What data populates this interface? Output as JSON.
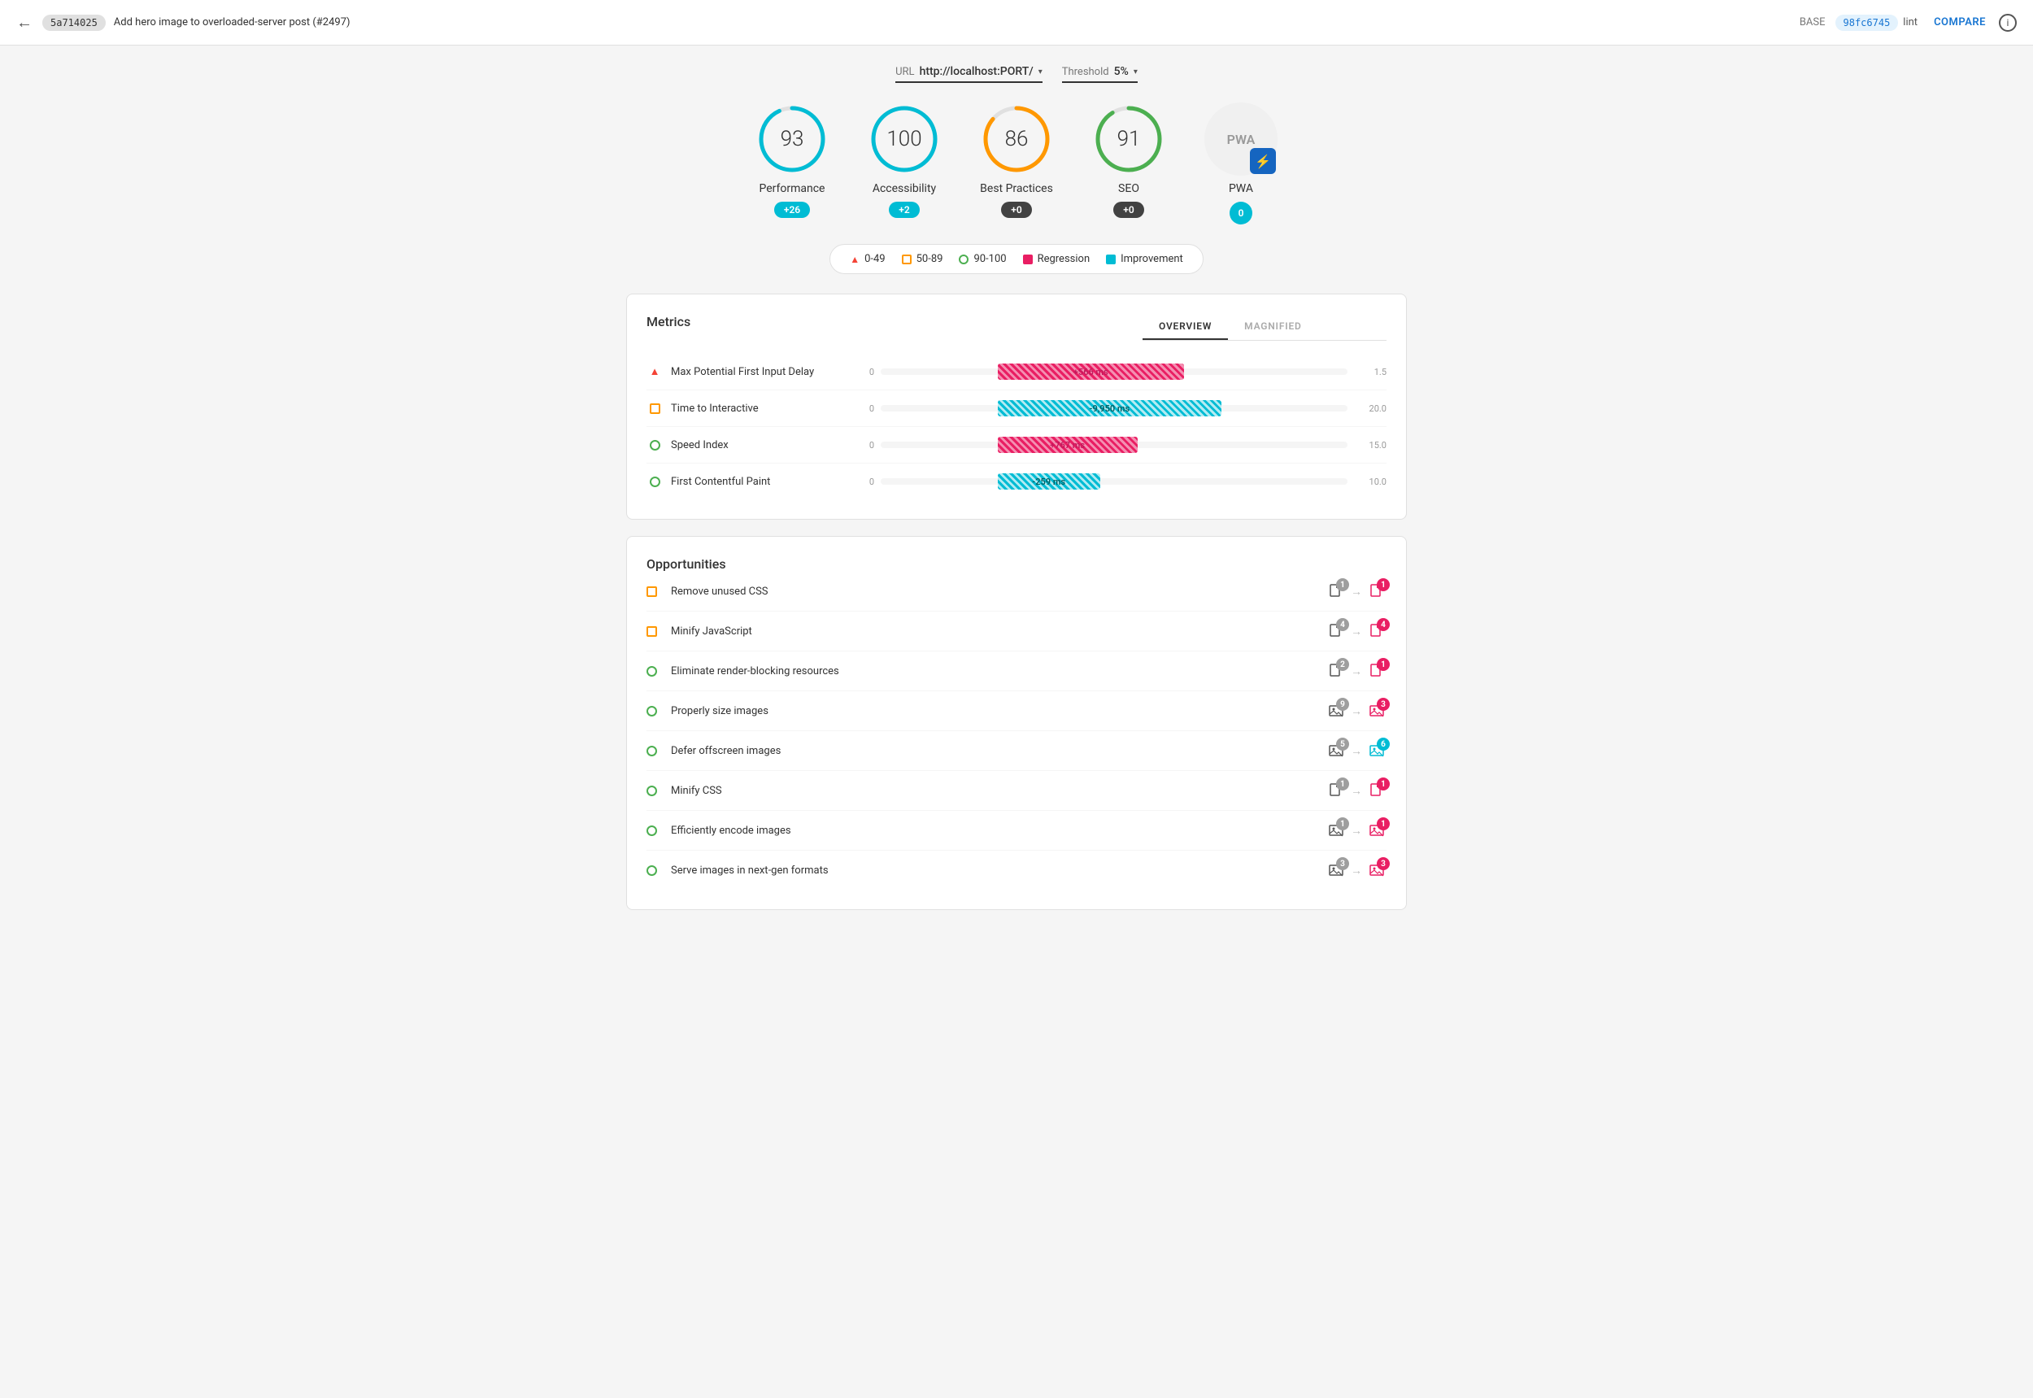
{
  "header": {
    "back_icon": "←",
    "commit_base": "5a714025",
    "commit_title": "Add hero image to overloaded-server post (#2497)",
    "base_label": "BASE",
    "commit_compare": "98fc6745",
    "lint_label": "lint",
    "compare_label": "COMPARE",
    "info_icon": "i"
  },
  "url_bar": {
    "url_label": "URL",
    "url_value": "http://localhost:PORT/",
    "threshold_label": "Threshold",
    "threshold_value": "5%"
  },
  "scores": [
    {
      "id": "performance",
      "value": "93",
      "label": "Performance",
      "badge": "+26",
      "badge_type": "blue",
      "stroke": "#00bcd4",
      "pct": 93
    },
    {
      "id": "accessibility",
      "value": "100",
      "label": "Accessibility",
      "badge": "+2",
      "badge_type": "blue",
      "stroke": "#00bcd4",
      "pct": 100
    },
    {
      "id": "best-practices",
      "value": "86",
      "label": "Best Practices",
      "badge": "+0",
      "badge_type": "dark",
      "stroke": "#ff9800",
      "pct": 86
    },
    {
      "id": "seo",
      "value": "91",
      "label": "SEO",
      "badge": "+0",
      "badge_type": "dark",
      "stroke": "#4caf50",
      "pct": 91
    },
    {
      "id": "pwa",
      "value": "PWA",
      "label": "PWA",
      "badge": "0",
      "badge_type": "blue-zero"
    }
  ],
  "legend": {
    "items": [
      {
        "id": "range-0-49",
        "icon": "triangle",
        "label": "0-49"
      },
      {
        "id": "range-50-89",
        "icon": "square",
        "label": "50-89"
      },
      {
        "id": "range-90-100",
        "icon": "circle",
        "label": "90-100"
      },
      {
        "id": "regression",
        "icon": "regression",
        "label": "Regression"
      },
      {
        "id": "improvement",
        "icon": "improvement",
        "label": "Improvement"
      }
    ]
  },
  "metrics": {
    "title": "Metrics",
    "tabs": [
      "OVERVIEW",
      "MAGNIFIED"
    ],
    "active_tab": "OVERVIEW",
    "rows": [
      {
        "id": "max-potential-fid",
        "icon": "triangle",
        "icon_color": "#f44336",
        "name": "Max Potential First Input Delay",
        "start": "0",
        "bar_type": "regression",
        "bar_label": "+566 ms",
        "bar_left_pct": 20,
        "bar_width_pct": 45,
        "end": "1.5"
      },
      {
        "id": "time-to-interactive",
        "icon": "square",
        "icon_color": "#ff9800",
        "name": "Time to Interactive",
        "start": "0",
        "bar_type": "improvement",
        "bar_label": "-9,950 ms",
        "bar_left_pct": 20,
        "bar_width_pct": 50,
        "end": "20.0"
      },
      {
        "id": "speed-index",
        "icon": "circle",
        "icon_color": "#4caf50",
        "name": "Speed Index",
        "start": "0",
        "bar_type": "regression",
        "bar_label": "+767 ms",
        "bar_left_pct": 20,
        "bar_width_pct": 35,
        "end": "15.0"
      },
      {
        "id": "first-contentful-paint",
        "icon": "circle",
        "icon_color": "#4caf50",
        "name": "First Contentful Paint",
        "start": "0",
        "bar_type": "improvement",
        "bar_label": "-259 ms",
        "bar_left_pct": 20,
        "bar_width_pct": 25,
        "end": "10.0"
      }
    ]
  },
  "opportunities": {
    "title": "Opportunities",
    "rows": [
      {
        "id": "remove-unused-css",
        "icon": "square",
        "icon_color": "#ff9800",
        "name": "Remove unused CSS",
        "base_count": "1",
        "compare_count": "1",
        "arrow": "→",
        "base_type": "file",
        "compare_type": "file-red"
      },
      {
        "id": "minify-javascript",
        "icon": "square",
        "icon_color": "#ff9800",
        "name": "Minify JavaScript",
        "base_count": "4",
        "compare_count": "4",
        "arrow": "→",
        "base_type": "file",
        "compare_type": "file-red"
      },
      {
        "id": "eliminate-render-blocking",
        "icon": "circle",
        "icon_color": "#4caf50",
        "name": "Eliminate render-blocking resources",
        "base_count": "2",
        "compare_count": "1",
        "arrow": "→",
        "base_type": "file",
        "compare_type": "file-red"
      },
      {
        "id": "properly-size-images",
        "icon": "circle",
        "icon_color": "#4caf50",
        "name": "Properly size images",
        "base_count": "9",
        "compare_count": "3",
        "arrow": "→",
        "base_type": "image",
        "compare_type": "image-red"
      },
      {
        "id": "defer-offscreen-images",
        "icon": "circle",
        "icon_color": "#4caf50",
        "name": "Defer offscreen images",
        "base_count": "5",
        "compare_count": "6",
        "arrow": "→",
        "base_type": "image",
        "compare_type": "image-cyan"
      },
      {
        "id": "minify-css",
        "icon": "circle",
        "icon_color": "#4caf50",
        "name": "Minify CSS",
        "base_count": "1",
        "compare_count": "1",
        "arrow": "→",
        "base_type": "file",
        "compare_type": "file-red"
      },
      {
        "id": "efficiently-encode-images",
        "icon": "circle",
        "icon_color": "#4caf50",
        "name": "Efficiently encode images",
        "base_count": "1",
        "compare_count": "1",
        "arrow": "→",
        "base_type": "image",
        "compare_type": "image-red"
      },
      {
        "id": "serve-next-gen-formats",
        "icon": "circle",
        "icon_color": "#4caf50",
        "name": "Serve images in next-gen formats",
        "base_count": "3",
        "compare_count": "3",
        "arrow": "→",
        "base_type": "image",
        "compare_type": "image-red"
      }
    ]
  }
}
